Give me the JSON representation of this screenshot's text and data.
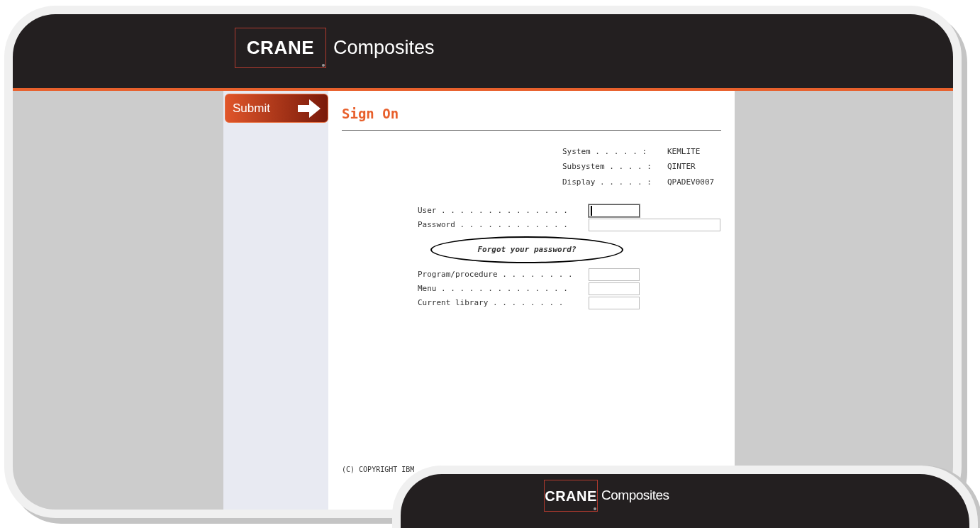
{
  "header": {
    "logo_mark": "CRANE",
    "logo_text": "Composites"
  },
  "sidebar": {
    "submit_button": "Submit"
  },
  "form": {
    "title": "Sign On",
    "system_info": [
      {
        "label": "System . . . . . :",
        "value": "KEMLITE"
      },
      {
        "label": "Subsystem . . . . :",
        "value": "QINTER"
      },
      {
        "label": "Display . . . . . :",
        "value": "QPADEV0007"
      }
    ],
    "fields_top": [
      {
        "label": "User . . . . . . . . . . . . . .",
        "kind": "short",
        "focused": true
      },
      {
        "label": "Password . . . . . . . . . . . .",
        "kind": "long",
        "focused": false
      }
    ],
    "forgot_link": "Forgot your password?",
    "fields_bottom": [
      {
        "label": "Program/procedure . . . . . . . .",
        "kind": "short",
        "focused": false
      },
      {
        "label": "Menu . . . . . . . . . . . . . .",
        "kind": "short",
        "focused": false
      },
      {
        "label": "Current library . . . . . . . .",
        "kind": "short",
        "focused": false
      }
    ],
    "copyright": "(C) COPYRIGHT IBM"
  },
  "second_window": {
    "logo_mark": "CRANE",
    "logo_text": "Composites"
  }
}
